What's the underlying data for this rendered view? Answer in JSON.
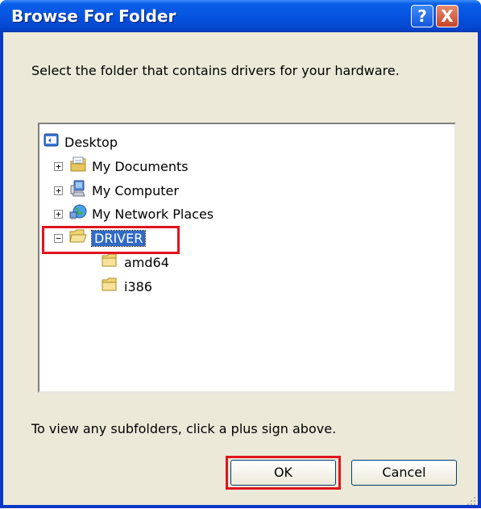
{
  "window": {
    "title": "Browse For Folder",
    "help_label": "?",
    "close_label": "X"
  },
  "description": "Select the folder that contains drivers for your hardware.",
  "tree": {
    "items": [
      {
        "label": "Desktop",
        "icon": "desktop-icon"
      },
      {
        "label": "My Documents",
        "icon": "my-documents-icon",
        "expander": "+"
      },
      {
        "label": "My Computer",
        "icon": "my-computer-icon",
        "expander": "+"
      },
      {
        "label": "My Network Places",
        "icon": "network-places-icon",
        "expander": "+"
      },
      {
        "label": "DRIVER",
        "icon": "folder-open-icon",
        "expander": "−",
        "selected": true
      },
      {
        "label": "amd64",
        "icon": "folder-icon"
      },
      {
        "label": "i386",
        "icon": "folder-icon"
      }
    ]
  },
  "footer_text": "To view any subfolders, click a plus sign above.",
  "buttons": {
    "ok": "OK",
    "cancel": "Cancel"
  },
  "colors": {
    "highlight": "#e0141e",
    "selection": "#316ac5",
    "titlebar": "#0553e0"
  }
}
